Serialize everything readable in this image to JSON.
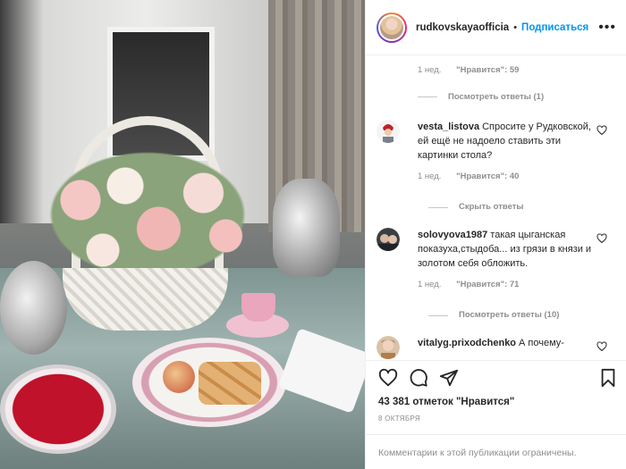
{
  "post": {
    "username": "rudkovskayaofficia",
    "follow_label": "Подписаться",
    "more_label": "•••"
  },
  "comments": {
    "top_meta": {
      "time": "1 нед.",
      "likes": "\"Нравится\": 59"
    },
    "top_replies": "Посмотреть ответы (1)",
    "items": [
      {
        "username": "vesta_listova",
        "text": "Спросите у Рудковской, ей ещё не надоело ставить эти картинки стола?",
        "time": "1 нед.",
        "likes": "\"Нравится\": 40",
        "replies": "Скрыть ответы"
      },
      {
        "username": "solovyova1987",
        "text": "такая цыганская показуха,стыдоба... из грязи в князи и золотом себя обложить.",
        "time": "1 нед.",
        "likes": "\"Нравится\": 71",
        "replies": "Посмотреть ответы (10)"
      },
      {
        "username": "vitalyg.prixodchenko",
        "text": "А почему-"
      }
    ]
  },
  "actions": {
    "likes_count": "43 381 отметок \"Нравится\"",
    "date": "8 ОКТЯБРЯ",
    "comments_closed": "Комментарии к этой публикации ограничены."
  }
}
